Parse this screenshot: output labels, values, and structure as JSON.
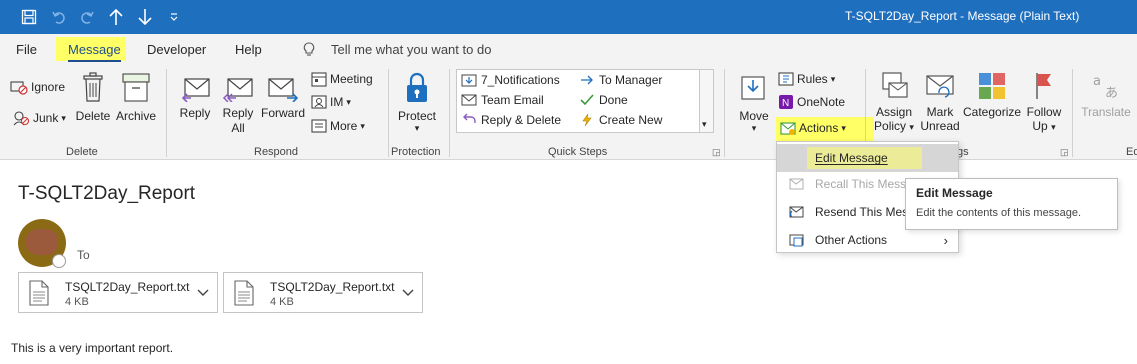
{
  "window": {
    "title": "T-SQLT2Day_Report  -  Message (Plain Text)"
  },
  "quick_access": {
    "icons": [
      "save-icon",
      "undo-icon",
      "redo-icon",
      "up-arrow-icon",
      "down-arrow-icon",
      "customize-icon"
    ]
  },
  "menu_tabs": [
    {
      "label": "File"
    },
    {
      "label": "Message"
    },
    {
      "label": "Developer"
    },
    {
      "label": "Help"
    }
  ],
  "tell_me": {
    "placeholder": "Tell me what you want to do"
  },
  "ribbon": {
    "delete_group": {
      "label": "Delete",
      "ignore": "Ignore",
      "junk": "Junk",
      "delete": "Delete",
      "archive": "Archive"
    },
    "respond_group": {
      "label": "Respond",
      "reply": "Reply",
      "reply_all_1": "Reply",
      "reply_all_2": "All",
      "forward": "Forward",
      "meeting": "Meeting",
      "im": "IM",
      "more": "More"
    },
    "protection_group": {
      "label": "Protection",
      "protect": "Protect"
    },
    "quick_steps_group": {
      "label": "Quick Steps",
      "items": [
        "7_Notifications",
        "To Manager",
        "Team Email",
        "Done",
        "Reply & Delete",
        "Create New"
      ]
    },
    "move_group": {
      "move": "Move",
      "rules": "Rules",
      "onenote": "OneNote",
      "actions": "Actions"
    },
    "tags_group": {
      "label_fragment": "gs",
      "assign_policy_1": "Assign",
      "assign_policy_2": "Policy",
      "mark_unread_1": "Mark",
      "mark_unread_2": "Unread",
      "categorize": "Categorize",
      "follow_up_1": "Follow",
      "follow_up_2": "Up",
      "translate": "Translate",
      "editing_fragment": "Ed"
    }
  },
  "actions_menu": {
    "items": [
      {
        "label": "Edit Message",
        "state": "selected"
      },
      {
        "label": "Recall This Messa",
        "state": "disabled"
      },
      {
        "label": "Resend This Mess",
        "state": "normal"
      },
      {
        "label": "Other Actions",
        "state": "normal"
      }
    ]
  },
  "tooltip": {
    "title": "Edit Message",
    "description": "Edit the contents of this message."
  },
  "message": {
    "subject": "T-SQLT2Day_Report",
    "to_label": "To",
    "attachments": [
      {
        "name": "TSQLT2Day_Report.txt",
        "size": "4 KB"
      },
      {
        "name": "TSQLT2Day_Report.txt",
        "size": "4 KB"
      }
    ],
    "body": "This is a very important report."
  },
  "colors": {
    "title_bar": "#1f6fbf",
    "highlight": "#ffff66",
    "ribbon_bg": "#f3f3f3",
    "active_tab": "#1f4e8c"
  }
}
